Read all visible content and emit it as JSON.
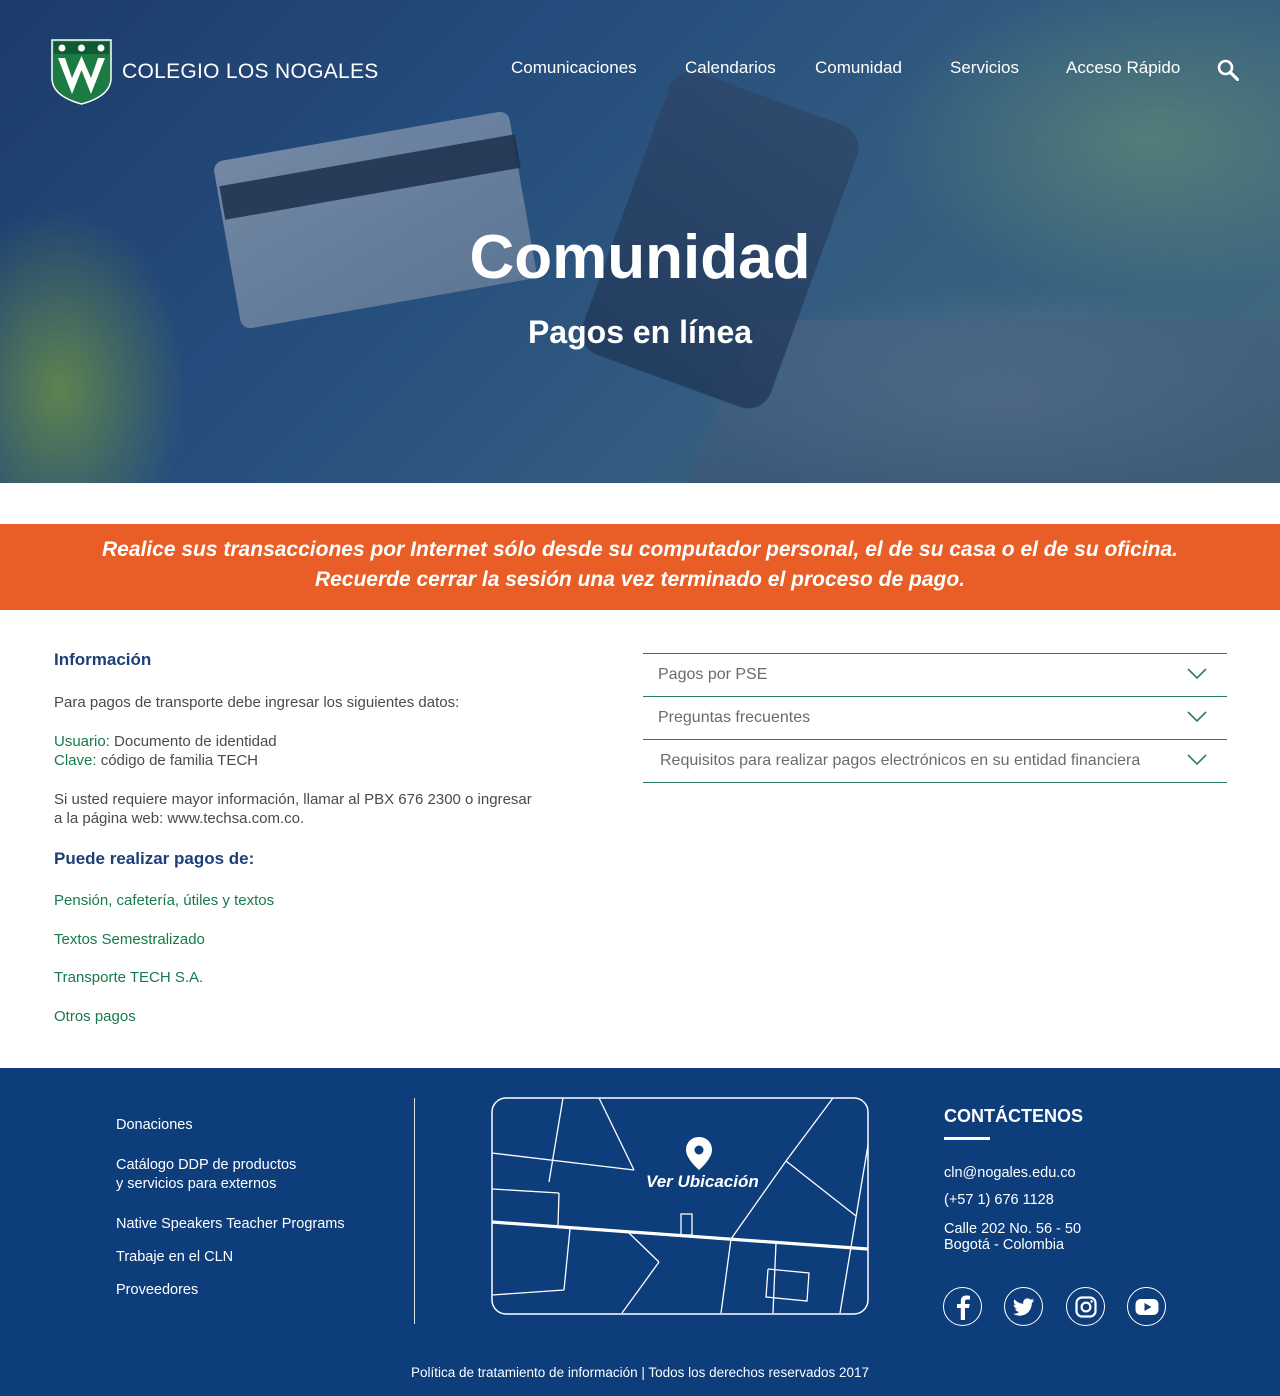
{
  "header": {
    "logo_text": "COLEGIO LOS NOGALES",
    "nav": [
      "Comunicaciones",
      "Calendarios",
      "Comunidad",
      "Servicios",
      "Acceso Rápido"
    ]
  },
  "hero": {
    "title": "Comunidad",
    "subtitle": "Pagos en línea"
  },
  "notice": {
    "line1": "Realice sus transacciones por Internet sólo desde su computador personal, el de su casa o el de su oficina.",
    "line2": "Recuerde cerrar la sesión una vez terminado el proceso de pago."
  },
  "info": {
    "heading": "Información",
    "intro": "Para pagos de transporte debe ingresar los siguientes datos:",
    "user_label": "Usuario:",
    "user_value": "Documento de identidad",
    "key_label": "Clave:",
    "key_value": "código de familia TECH",
    "more_line1": "Si usted requiere mayor información, llamar al PBX 676 2300 o ingresar",
    "more_line2": "a la página web: www.techsa.com.co.",
    "payments_heading": "Puede realizar pagos de:",
    "payments": [
      "Pensión, cafetería, útiles y textos",
      "Textos Semestralizado",
      "Transporte TECH S.A.",
      "Otros pagos"
    ]
  },
  "accordion": [
    "Pagos por PSE",
    "Preguntas frecuentes",
    "Requisitos para realizar pagos electrónicos en su entidad financiera"
  ],
  "footer": {
    "links": [
      "Donaciones",
      "Catálogo DDP de productos",
      "y servicios para externos",
      "Native Speakers Teacher Programs",
      "Trabaje en el CLN",
      "Proveedores"
    ],
    "map_label": "Ver Ubicación",
    "contact_title": "CONTÁCTENOS",
    "email": "cln@nogales.edu.co",
    "phone": "(+57 1) 676 1128",
    "address1": "Calle 202 No. 56 - 50",
    "address2": "Bogotá - Colombia",
    "social_icons": [
      "facebook-icon",
      "twitter-icon",
      "instagram-icon",
      "youtube-icon"
    ],
    "bottom": "Política de tratamiento de información | Todos los derechos reservados 2017"
  },
  "colors": {
    "notice_bg": "#e85e26",
    "footer_bg": "#0d3d7a",
    "heading_blue": "#1c3f7a",
    "link_green": "#167a4a",
    "accordion_rule": "#2f7b6a"
  }
}
